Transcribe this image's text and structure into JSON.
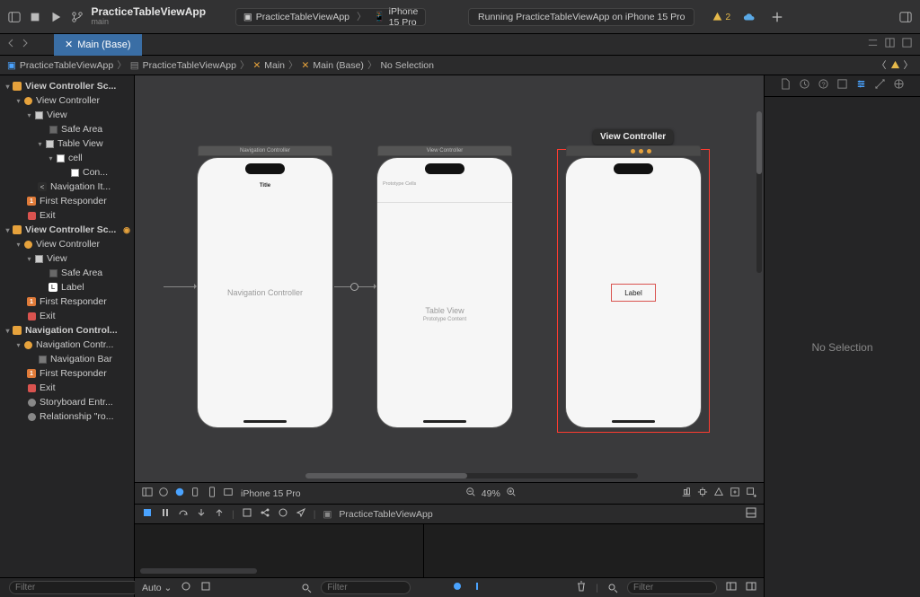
{
  "titlebar": {
    "project": "PracticeTableViewApp",
    "branch": "main",
    "scheme_app": "PracticeTableViewApp",
    "scheme_device": "iPhone 15 Pro",
    "status": "Running PracticeTableViewApp on iPhone 15 Pro",
    "warning_count": "2"
  },
  "tab": {
    "filename": "Main (Base)"
  },
  "breadcrumb": {
    "items": [
      "PracticeTableViewApp",
      "PracticeTableViewApp",
      "Main",
      "Main (Base)",
      "No Selection"
    ]
  },
  "outline": {
    "s1": {
      "title": "View Controller Sc...",
      "vc": "View Controller",
      "view": "View",
      "safe": "Safe Area",
      "table": "Table View",
      "cell": "cell",
      "content": "Con...",
      "navitem": "Navigation It...",
      "first": "First Responder",
      "exit": "Exit"
    },
    "s2": {
      "title": "View Controller Sc...",
      "vc": "View Controller",
      "view": "View",
      "safe": "Safe Area",
      "label": "Label",
      "first": "First Responder",
      "exit": "Exit"
    },
    "s3": {
      "title": "Navigation Control...",
      "nc": "Navigation Contr...",
      "navbar": "Navigation Bar",
      "first": "First Responder",
      "exit": "Exit",
      "entry": "Storyboard Entr...",
      "rel": "Relationship \"ro..."
    },
    "filter_placeholder": "Filter"
  },
  "canvas": {
    "scene1_label": "Navigation Controller",
    "scene2_label": "View Controller",
    "nav_title": "Title",
    "proto_header": "Prototype Cells",
    "tv_big": "Table View",
    "tv_small": "Prototype Content",
    "navc_big": "Navigation Controller",
    "label_text": "Label",
    "tooltip": "View Controller"
  },
  "canvasbar": {
    "device": "iPhone 15 Pro",
    "zoom": "49%"
  },
  "debugbar": {
    "process": "PracticeTableViewApp"
  },
  "debugfoot": {
    "auto": "Auto",
    "filter_placeholder": "Filter",
    "filter2_placeholder": "Filter"
  },
  "inspector": {
    "empty": "No Selection"
  }
}
